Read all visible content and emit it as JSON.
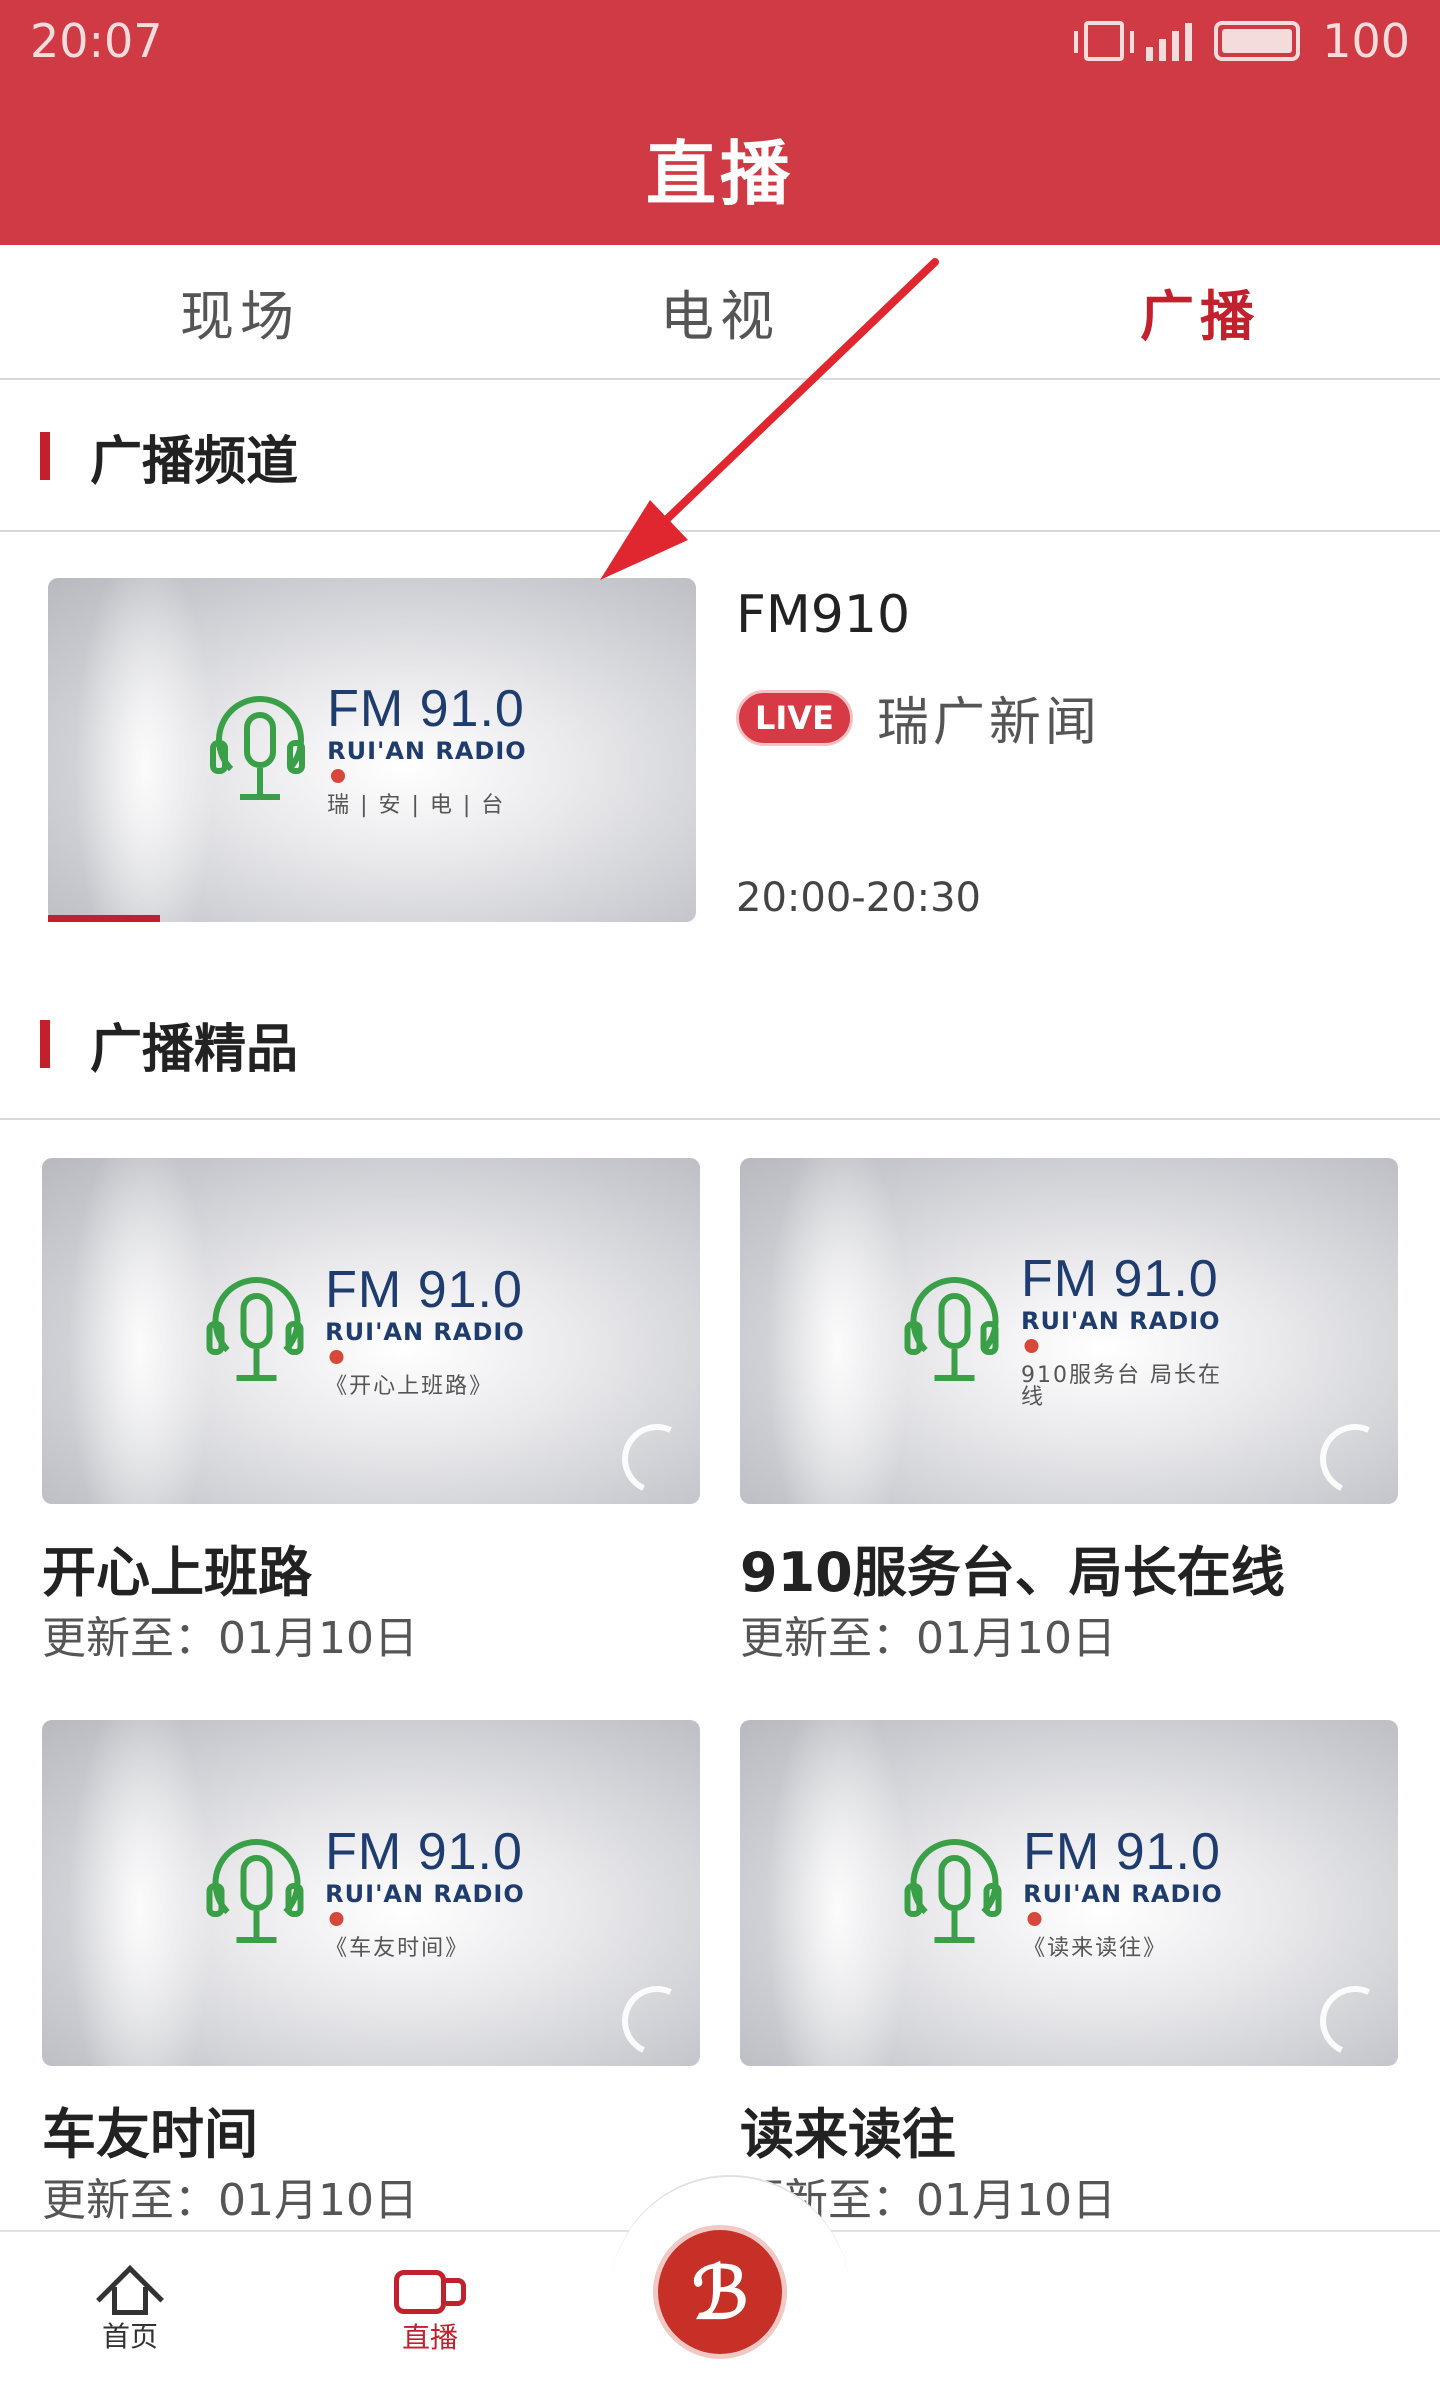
{
  "status_bar": {
    "time": "20:07",
    "battery": "100"
  },
  "header": {
    "title": "直播"
  },
  "tabs": [
    {
      "label": "现场"
    },
    {
      "label": "电视"
    },
    {
      "label": "广播"
    }
  ],
  "sections": {
    "channels": {
      "title": "广播频道"
    },
    "premium": {
      "title": "广播精品"
    }
  },
  "logo": {
    "fm": "FM 91.0",
    "sub": "RUI'AN RADIO"
  },
  "live_channel": {
    "name": "FM910",
    "live_badge": "LIVE",
    "program": "瑞广新闻",
    "time": "20:00-20:30",
    "logo_tag": "瑞 | 安 | 电 | 台"
  },
  "programs": [
    {
      "title": "开心上班路",
      "updated": "更新至：01月10日",
      "logo_tag": "《开心上班路》"
    },
    {
      "title": "910服务台、局长在线",
      "updated": "更新至：01月10日",
      "logo_tag": "910服务台 局长在线"
    },
    {
      "title": "车友时间",
      "updated": "更新至：01月10日",
      "logo_tag": "《车友时间》"
    },
    {
      "title": "读来读往",
      "updated": "更新至：01月10日",
      "logo_tag": "《读来读往》"
    }
  ],
  "bottom_nav": {
    "home": "首页",
    "live": "直播"
  },
  "colors": {
    "accent": "#cf3a44",
    "active": "#c2202c",
    "logo_green": "#3aa047",
    "logo_blue": "#1e3c6e"
  }
}
